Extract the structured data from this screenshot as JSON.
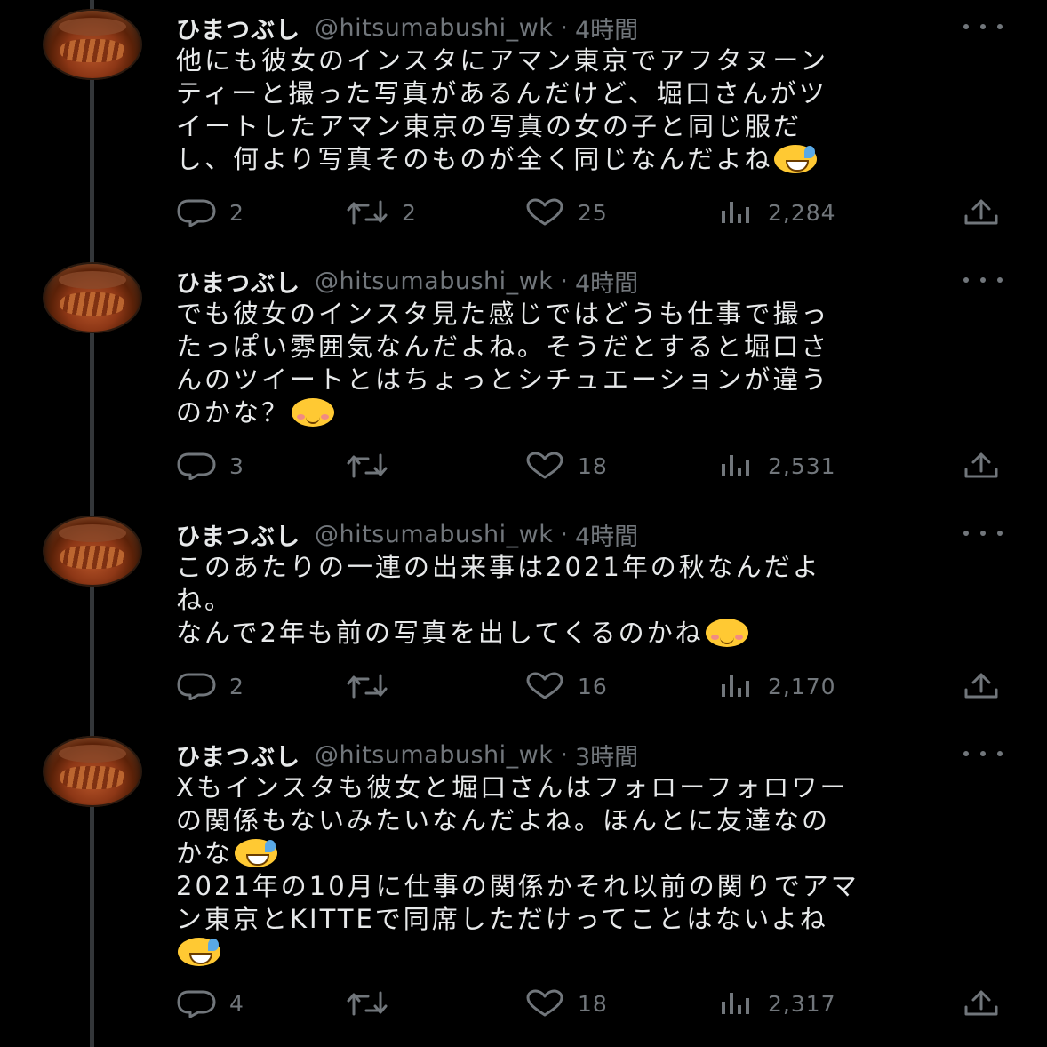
{
  "tweets": [
    {
      "name": "ひまつぶし",
      "handle": "@hitsumabushi_wk",
      "separator": "·",
      "time": "4時間",
      "lines": [
        "他にも彼女のインスタにアマン東京でアフタヌーン",
        "ティーと撮った写真があるんだけど、堀口さんがツ",
        "イートしたアマン東京の写真の女の子と同じ服だ",
        "し、何より写真そのものが全く同じなんだよね"
      ],
      "emoji": [
        {
          "line": 3,
          "type": "sweat-smile-emoji"
        }
      ],
      "replies": "2",
      "reposts": "2",
      "likes": "25",
      "views": "2,284"
    },
    {
      "name": "ひまつぶし",
      "handle": "@hitsumabushi_wk",
      "separator": "·",
      "time": "4時間",
      "lines": [
        "でも彼女のインスタ見た感じではどうも仕事で撮っ",
        "たっぽい雰囲気なんだよね。そうだとすると堀口さ",
        "んのツイートとはちょっとシチュエーションが違う",
        "のかな？"
      ],
      "emoji": [
        {
          "line": 3,
          "type": "smiling-blush-emoji"
        }
      ],
      "replies": "3",
      "reposts": "",
      "likes": "18",
      "views": "2,531"
    },
    {
      "name": "ひまつぶし",
      "handle": "@hitsumabushi_wk",
      "separator": "·",
      "time": "4時間",
      "lines": [
        "このあたりの一連の出来事は2021年の秋なんだよ",
        "ね。",
        "なんで2年も前の写真を出してくるのかね"
      ],
      "emoji": [
        {
          "line": 2,
          "type": "smiling-blush-emoji"
        }
      ],
      "replies": "2",
      "reposts": "",
      "likes": "16",
      "views": "2,170"
    },
    {
      "name": "ひまつぶし",
      "handle": "@hitsumabushi_wk",
      "separator": "·",
      "time": "3時間",
      "lines": [
        "Xもインスタも彼女と堀口さんはフォローフォロワー",
        "の関係もないみたいなんだよね。ほんとに友達なの",
        "かな",
        "2021年の10月に仕事の関係かそれ以前の関りでアマ",
        "ン東京とKITTEで同席しただけってことはないよね",
        ""
      ],
      "emoji": [
        {
          "line": 2,
          "type": "sweat-smile-emoji"
        },
        {
          "line": 5,
          "type": "sweat-smile-emoji"
        }
      ],
      "replies": "4",
      "reposts": "",
      "likes": "18",
      "views": "2,317"
    }
  ],
  "icons": {
    "reply": "reply-icon",
    "repost": "repost-icon",
    "like": "heart-icon",
    "views": "views-icon",
    "share": "share-icon",
    "more": "more-icon"
  },
  "colors": {
    "background": "#000000",
    "text": "#e7e9ea",
    "muted": "#71767b",
    "thread_line": "#333639"
  }
}
